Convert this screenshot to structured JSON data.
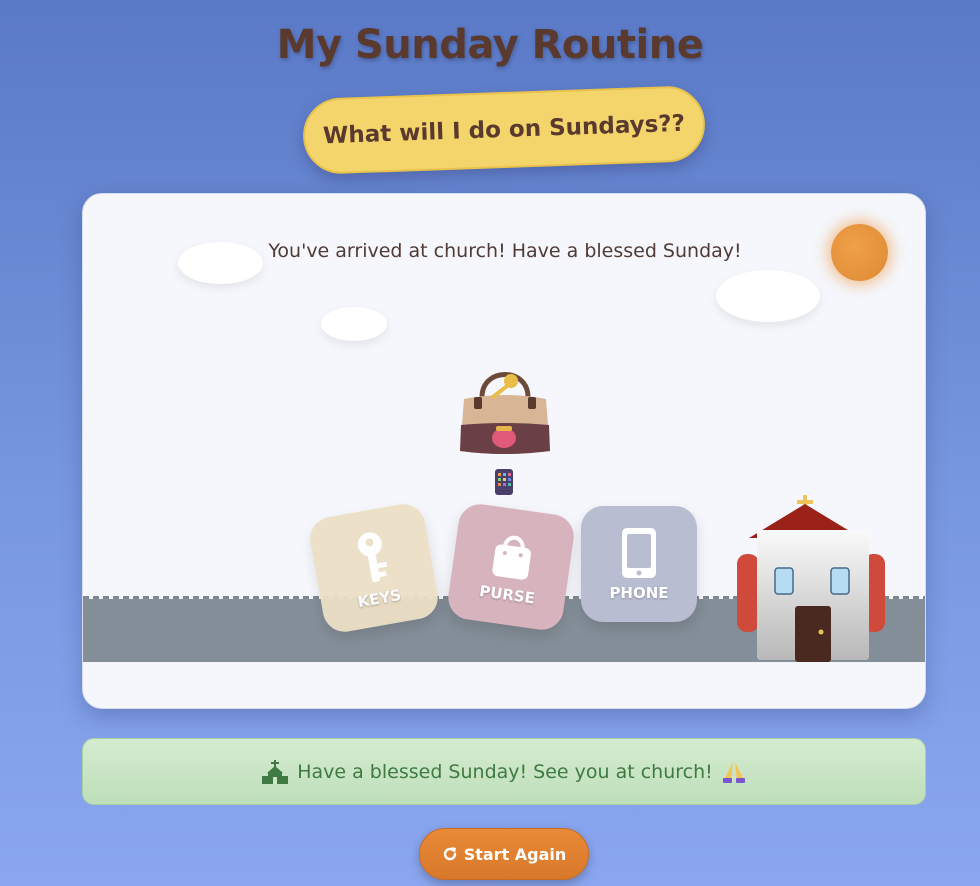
{
  "header": {
    "title": "My Sunday Routine",
    "subtitle": "What will I do on Sundays??"
  },
  "scene": {
    "status_message": "You've arrived at church! Have a blessed Sunday!",
    "items": [
      {
        "label": "KEYS",
        "icon": "key-icon"
      },
      {
        "label": "PURSE",
        "icon": "purse-icon"
      },
      {
        "label": "PHONE",
        "icon": "phone-icon"
      }
    ],
    "decorations": [
      "sun-icon",
      "cloud-icon",
      "handbag-icon",
      "church-icon"
    ]
  },
  "banner": {
    "text": "Have a blessed Sunday! See you at church!",
    "leading_icon": "church-icon",
    "trailing_icon": "praying-hands-icon"
  },
  "controls": {
    "restart_label": "Start Again",
    "restart_icon": "refresh-icon"
  },
  "colors": {
    "background": "#6b8ad8",
    "title": "#5a3a2e",
    "pill": "#f4d56b",
    "road": "#848e98",
    "banner_bg": "#cfe7cb",
    "banner_text": "#3e7a41",
    "button": "#e3823a"
  }
}
